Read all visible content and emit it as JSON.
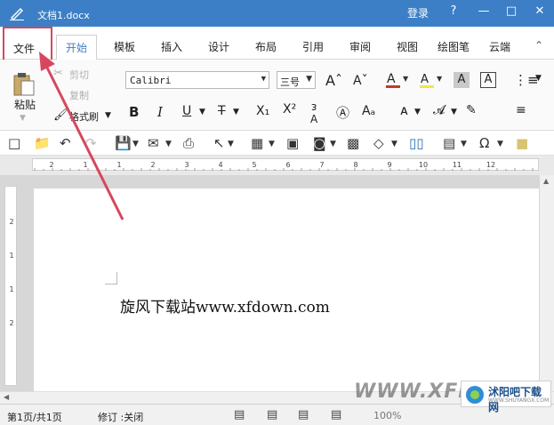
{
  "titlebar": {
    "doc_title": "文档1.docx",
    "login": "登录",
    "help": "?"
  },
  "tabs": {
    "file": "文件",
    "home": "开始",
    "template": "模板",
    "insert": "插入",
    "design": "设计",
    "layout": "布局",
    "references": "引用",
    "review": "审阅",
    "view": "视图",
    "draw": "绘图笔",
    "cloud": "云端"
  },
  "clipboard": {
    "paste": "粘贴",
    "cut": "剪切",
    "copy": "复制",
    "format_painter": "格式刷"
  },
  "font": {
    "name": "Calibri",
    "size": "三号"
  },
  "document": {
    "text": "旋风下载站www.xfdown.com"
  },
  "ruler": {
    "h_labels": [
      "2",
      "1",
      "1",
      "2",
      "3",
      "4",
      "5",
      "6",
      "7",
      "8",
      "9",
      "10",
      "11",
      "12"
    ],
    "v_labels": [
      "2",
      "1",
      "1",
      "2"
    ]
  },
  "status": {
    "page": "第1页/共1页",
    "track": "修订 :关闭",
    "zoom": "100%"
  },
  "watermark": {
    "text": "WWW.XFDO",
    "logo_title": "沭阳吧下载网",
    "logo_sub": "WWW.SHUYANGX.COM"
  },
  "colors": {
    "accent": "#3c7fc6",
    "highlight": "#d6475f"
  }
}
